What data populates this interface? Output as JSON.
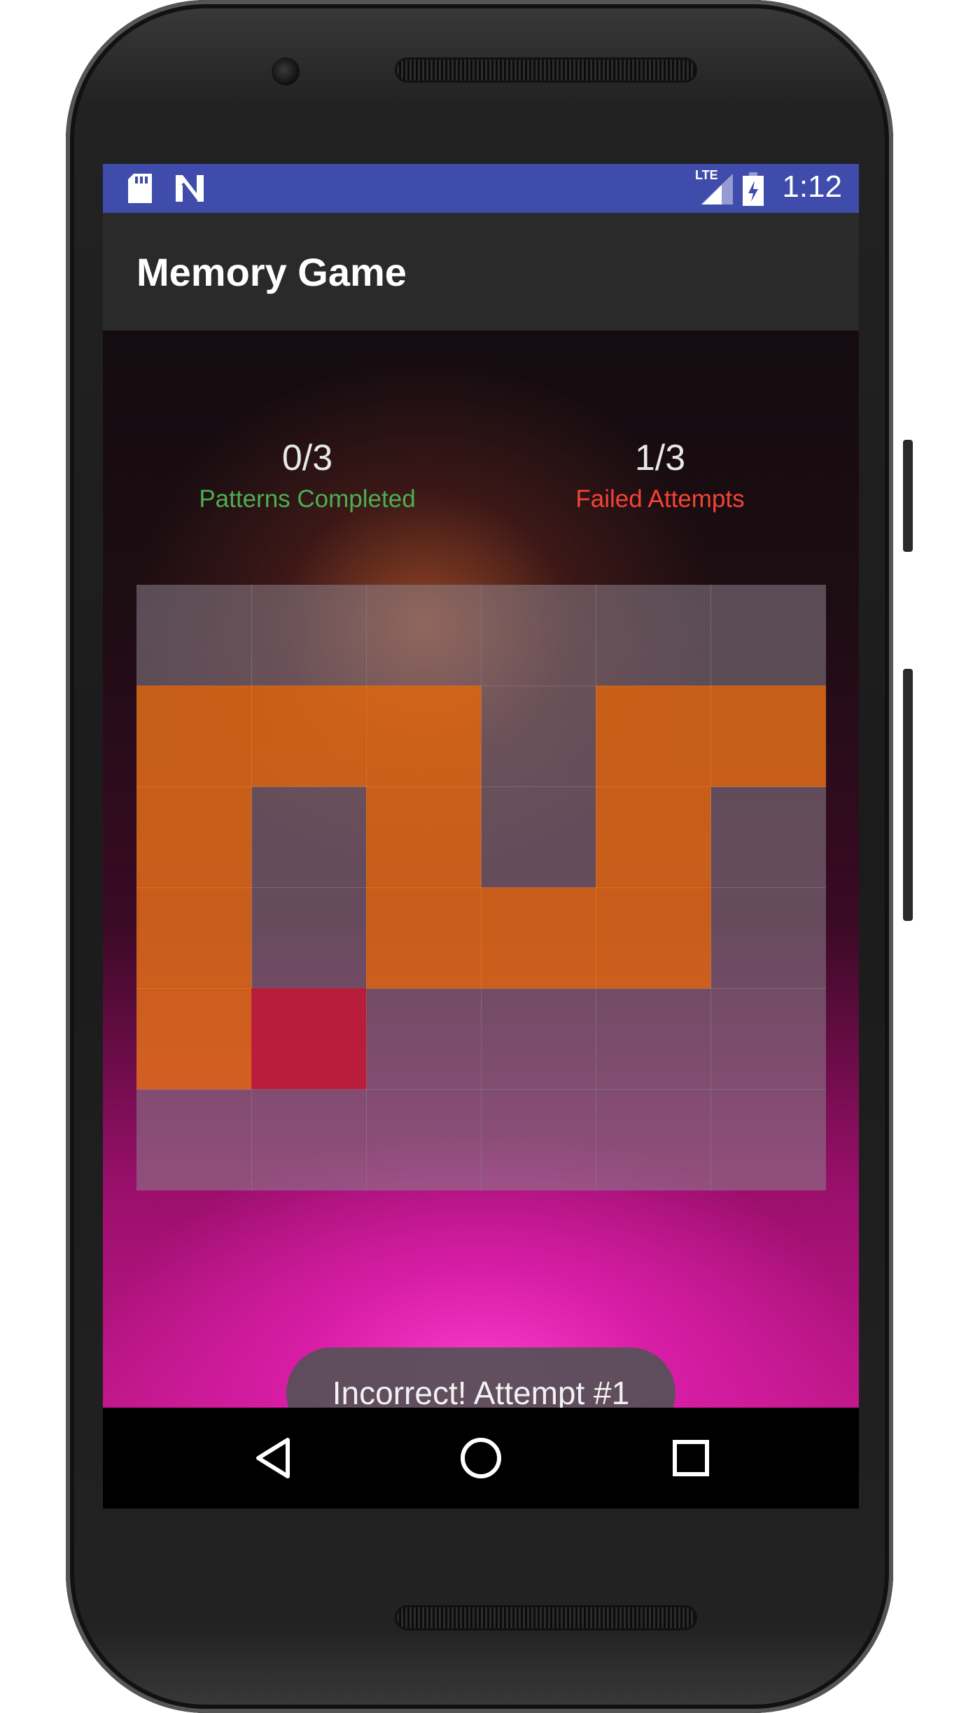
{
  "status_bar": {
    "time": "1:12",
    "network_label": "LTE",
    "icons": [
      "sd-card-icon",
      "n-logo-icon",
      "signal-icon",
      "battery-charging-icon"
    ]
  },
  "toolbar": {
    "title": "Memory Game"
  },
  "scores": {
    "completed_value": "0/3",
    "completed_label": "Patterns Completed",
    "failed_value": "1/3",
    "failed_label": "Failed Attempts"
  },
  "grid": {
    "rows": 6,
    "cols": 6,
    "cells": [
      [
        "empty",
        "empty",
        "empty",
        "empty",
        "empty",
        "empty"
      ],
      [
        "pattern",
        "pattern",
        "pattern",
        "empty",
        "pattern",
        "pattern"
      ],
      [
        "pattern",
        "empty",
        "pattern",
        "empty",
        "pattern",
        "empty"
      ],
      [
        "pattern",
        "empty",
        "pattern",
        "pattern",
        "pattern",
        "empty"
      ],
      [
        "pattern",
        "wrong",
        "empty",
        "empty",
        "empty",
        "empty"
      ],
      [
        "empty",
        "empty",
        "empty",
        "empty",
        "empty",
        "empty"
      ]
    ]
  },
  "toast": {
    "message": "Incorrect! Attempt #1"
  },
  "nav": {
    "icons": [
      "back-icon",
      "home-icon",
      "recents-icon"
    ]
  },
  "colors": {
    "status_bar": "#3f4cab",
    "toolbar": "#2a2a2a",
    "completed_text": "#4caf50",
    "failed_text": "#f44336",
    "cell_empty": "rgba(140,130,140,0.55)",
    "cell_pattern": "#e8701a",
    "cell_wrong": "#c21f3a"
  }
}
